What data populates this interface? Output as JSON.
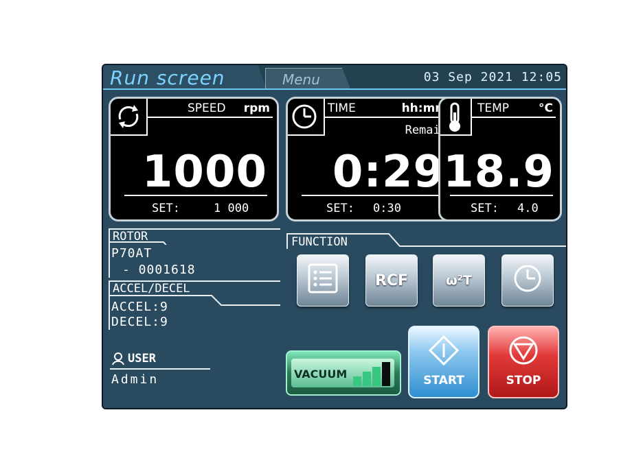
{
  "header": {
    "active_tab": "Run screen",
    "menu_tab": "Menu",
    "datetime": "03 Sep 2021 12:05"
  },
  "speed": {
    "label": "SPEED",
    "unit": "rpm",
    "value": "1000",
    "set_label": "SET:",
    "set_value": "1 000",
    "icon": "rotation-icon"
  },
  "time": {
    "label": "TIME",
    "unit": "hh:mm",
    "mode": "Remain",
    "value": "0:29",
    "set_label": "SET:",
    "set_value": "0:30",
    "icon": "clock-icon"
  },
  "temp": {
    "label": "TEMP",
    "unit": "°C",
    "value": "18.9",
    "set_label": "SET:",
    "set_value": "4.0",
    "icon": "thermometer-icon"
  },
  "rotor": {
    "title": "ROTOR",
    "model": "P70AT",
    "serial": "- 0001618"
  },
  "accel_decel": {
    "title": "ACCEL/DECEL",
    "accel": "ACCEL:9",
    "decel": "DECEL:9"
  },
  "user": {
    "title": "USER",
    "name": "Admin",
    "icon": "user-icon"
  },
  "function": {
    "title": "FUNCTION",
    "buttons": [
      {
        "label": "",
        "icon": "list-icon"
      },
      {
        "label": "RCF",
        "icon": ""
      },
      {
        "label": "ω²T",
        "icon": ""
      },
      {
        "label": "",
        "icon": "timer-icon"
      }
    ]
  },
  "vacuum": {
    "label": "VACUUM",
    "level": 0.75
  },
  "controls": {
    "start": "START",
    "stop": "STOP"
  },
  "colors": {
    "accent": "#6fc6f2",
    "panel": "#2a4a5f",
    "start": "#2f8fd0",
    "stop": "#e23a3a",
    "vacuum": "#2a7a58"
  }
}
